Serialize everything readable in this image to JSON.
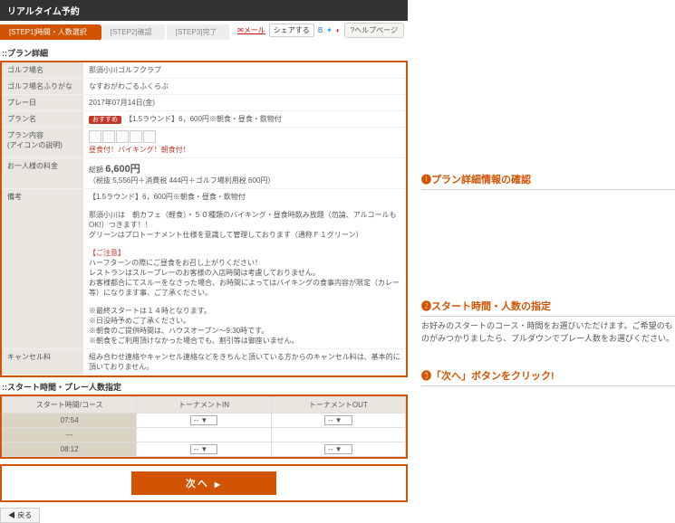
{
  "header": {
    "title": "リアルタイム予約"
  },
  "steps": {
    "s1": "[STEP1]時間・人数選択",
    "s2": "[STEP2]確認",
    "s3": "[STEP3]完了"
  },
  "toolbar": {
    "mail": "メール",
    "share": "シェアする",
    "help": "ヘルプページ"
  },
  "detail": {
    "title": "::プラン詳細",
    "course_l": "ゴルフ場名",
    "course_v": "那須小川ゴルフクラブ",
    "kana_l": "ゴルフ場名ふりがな",
    "kana_v": "なすおがわごるふくらぶ",
    "date_l": "プレー日",
    "date_v": "2017年07月14日(金)",
    "plan_l": "プラン名",
    "plan_badge": "おすすめ",
    "plan_v": "【1.5ラウンド】6，600円※朝食・昼食・飲物付",
    "cont_l": "プラン内容",
    "cont_sub": "(アイコンの説明)",
    "cont_v": "昼食付！バイキング！朝食付！",
    "price_l": "お一人様の料金",
    "price_pre": "総額",
    "price_v": "6,600円",
    "price_note": "（税抜 5,556円＋消費税 444円＋ゴルフ場利用税 600円）",
    "notes_l": "備考",
    "n1": "【1.5ラウンド】6，600円※朝食・昼食・飲物付",
    "n2": "那須小川は　朝カフェ（軽食）・５０種類のバイキング・昼食時飲み放題（勿論、アルコールもOK!）つきます！！",
    "n3": "グリーンはプロトーナメント仕様を意識して管理しております（通称Ｆ１グリーン）",
    "n4": "【ご注意】",
    "n5": "ハーフターンの際にご昼食をお召し上がりください！",
    "n6": "レストランはスループレーのお客様の入店時間は考慮しておりません。",
    "n7": "お客様都合にてスルーをなさった場合、お時間によってはバイキングの食事内容が限定（カレー等）になります事、ご了承ください。",
    "n8": "※最終スタートは１４時となります。",
    "n9": "※日没時予めご了承ください。",
    "n10": "※朝食のご提供時間は、ハウスオープン〜9:30時です。",
    "n11": "※朝食をご利用頂けなかった場合でも、割引等は御座いません。",
    "cancel_l": "キャンセル料",
    "cancel_v": "組み合わせ連絡やキャンセル連絡などをきちんと頂いている方からのキャンセル料は、基本的に頂いておりません。"
  },
  "tt": {
    "title": "::スタート時間・プレー人数指定",
    "h1": "スタート時間/コース",
    "h2": "トーナメントIN",
    "h3": "トーナメントOUT",
    "r1": "07:54",
    "r2": "---",
    "r3": "08:12",
    "dash": "--",
    "sel": "▼"
  },
  "next": {
    "label": "次へ"
  },
  "back": {
    "label": "戻る",
    "arrow": "◀"
  },
  "callouts": {
    "c1": "❶プラン詳細情報の確認",
    "c2": "❷スタート時間・人数の指定",
    "c2d": "お好みのスタートのコース・時間をお選びいただけます。ご希望のものがみつかりましたら、プルダウンでプレー人数をお選びください。",
    "c3": "❸「次へ」ボタンをクリック!"
  }
}
